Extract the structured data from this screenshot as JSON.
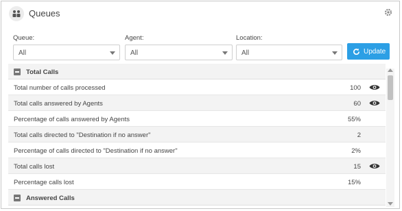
{
  "header": {
    "title": "Queues",
    "icon": "queue-people-icon",
    "settings_icon": "gear-icon"
  },
  "filters": {
    "queue": {
      "label": "Queue:",
      "value": "All"
    },
    "agent": {
      "label": "Agent:",
      "value": "All"
    },
    "location": {
      "label": "Location:",
      "value": "All"
    },
    "update_label": "Update",
    "update_color": "#2c9fe5"
  },
  "table": {
    "section_total": "Total Calls",
    "rows": [
      {
        "label": "Total number of calls processed",
        "value": "100",
        "eye": true
      },
      {
        "label": "Total calls answered by Agents",
        "value": "60",
        "eye": true
      },
      {
        "label": "Percentage of calls answered by Agents",
        "value": "55%",
        "eye": false
      },
      {
        "label": "Total calls directed to \"Destination if no answer\"",
        "value": "2",
        "eye": false
      },
      {
        "label": "Percentage of calls directed to \"Destination if no answer\"",
        "value": "2%",
        "eye": false
      },
      {
        "label": "Total calls lost",
        "value": "15",
        "eye": true
      },
      {
        "label": "Percentage calls lost",
        "value": "15%",
        "eye": false
      }
    ],
    "section_answered": "Answered Calls"
  }
}
